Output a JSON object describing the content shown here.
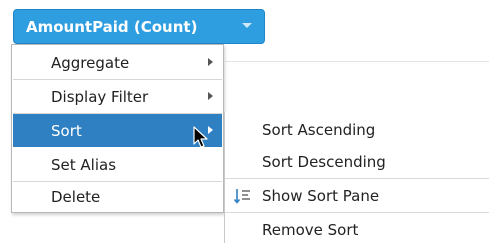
{
  "field": {
    "label": "AmountPaid (Count)",
    "accent_color": "#2f9ee0"
  },
  "context_menu": {
    "items": [
      {
        "label": "Aggregate",
        "has_submenu": true
      },
      {
        "label": "Display Filter",
        "has_submenu": true
      },
      {
        "label": "Sort",
        "has_submenu": true,
        "active": true
      },
      {
        "label": "Set Alias",
        "has_submenu": false
      },
      {
        "label": "Delete",
        "has_submenu": false
      }
    ],
    "active_color": "#2f80c2"
  },
  "sort_submenu": {
    "items": [
      {
        "label": "Sort Ascending"
      },
      {
        "label": "Sort Descending"
      },
      {
        "label": "Show Sort Pane",
        "icon": "sort-pane-icon"
      },
      {
        "label": "Remove Sort"
      }
    ]
  }
}
